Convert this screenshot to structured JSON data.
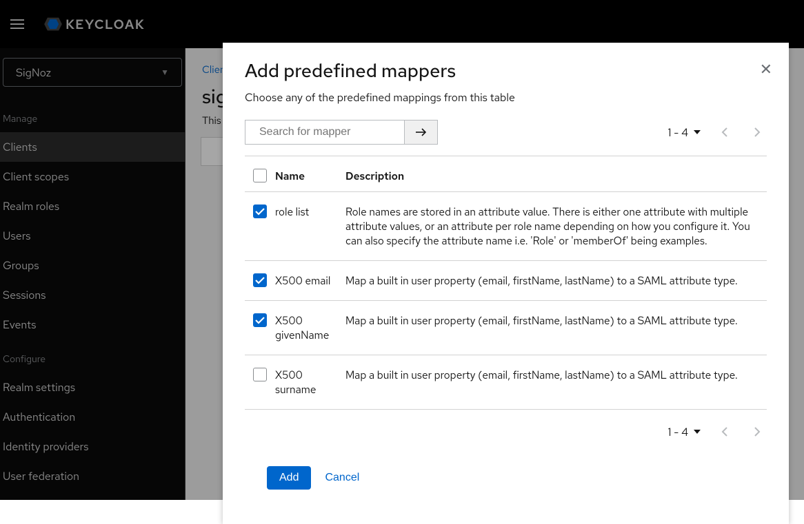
{
  "header": {
    "brand": "KEYCLOAK"
  },
  "sidebar": {
    "realm": "SigNoz",
    "section_manage": "Manage",
    "section_configure": "Configure",
    "items_manage": [
      "Clients",
      "Client scopes",
      "Realm roles",
      "Users",
      "Groups",
      "Sessions",
      "Events"
    ],
    "items_configure": [
      "Realm settings",
      "Authentication",
      "Identity providers",
      "User federation"
    ]
  },
  "main": {
    "breadcrumb": "Clien",
    "title": "sig",
    "subtitle": "This"
  },
  "modal": {
    "title": "Add predefined mappers",
    "description": "Choose any of the predefined mappings from this table",
    "search_placeholder": "Search for mapper",
    "page_range": "1 - 4",
    "columns": {
      "name": "Name",
      "description": "Description"
    },
    "rows": [
      {
        "checked": true,
        "name": "role list",
        "desc": "Role names are stored in an attribute value. There is either one attribute with multiple attribute values, or an attribute per role name depending on how you configure it. You can also specify the attribute name i.e. 'Role' or 'memberOf' being examples."
      },
      {
        "checked": true,
        "name": "X500 email",
        "desc": "Map a built in user property (email, firstName, lastName) to a SAML attribute type."
      },
      {
        "checked": true,
        "name": "X500 givenName",
        "desc": "Map a built in user property (email, firstName, lastName) to a SAML attribute type."
      },
      {
        "checked": false,
        "name": "X500 surname",
        "desc": "Map a built in user property (email, firstName, lastName) to a SAML attribute type."
      }
    ],
    "add_label": "Add",
    "cancel_label": "Cancel"
  }
}
